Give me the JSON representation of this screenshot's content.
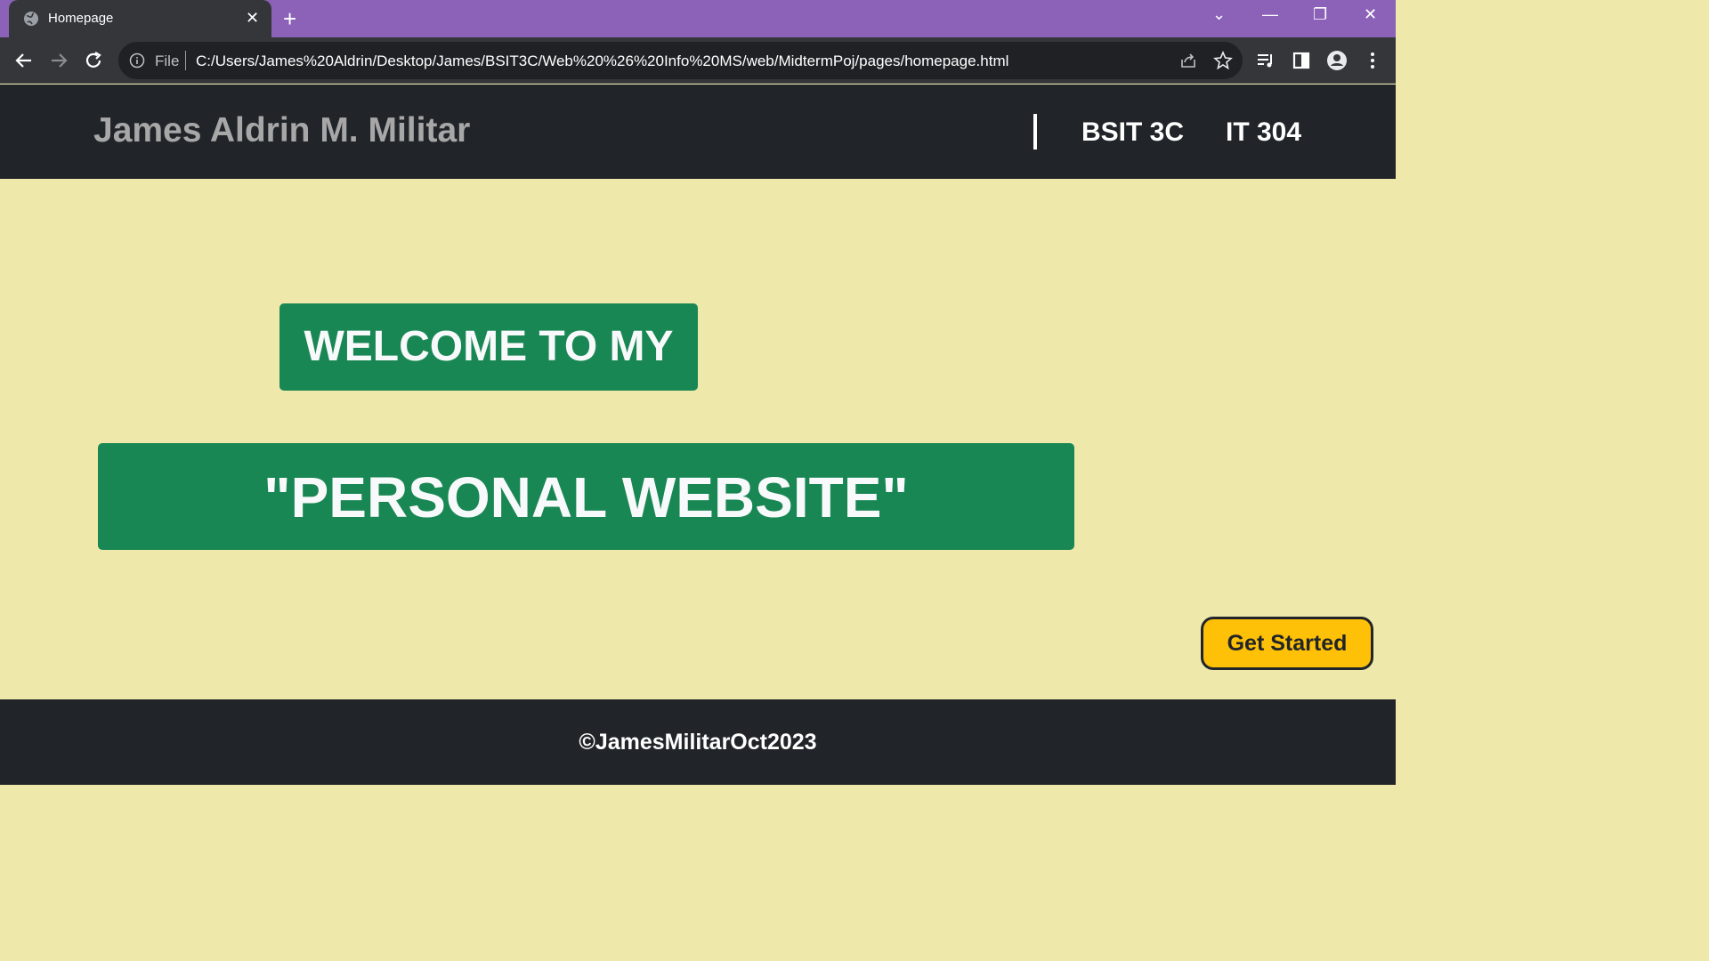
{
  "browser": {
    "tab_title": "Homepage",
    "address_prefix": "File",
    "url": "C:/Users/James%20Aldrin/Desktop/James/BSIT3C/Web%20%26%20Info%20MS/web/MidtermPoj/pages/homepage.html"
  },
  "header": {
    "brand": "James Aldrin M. Militar",
    "nav": [
      "BSIT 3C",
      "IT 304"
    ]
  },
  "hero": {
    "line1": "WELCOME TO MY",
    "line2": "\"PERSONAL WEBSITE\""
  },
  "cta_label": "Get Started",
  "footer": {
    "copyright": "©JamesMilitarOct2023"
  },
  "colors": {
    "tabbar": "#8b62b8",
    "page_bg": "#eee8aa",
    "dark": "#212529",
    "green": "#198754",
    "cta": "#ffc107"
  }
}
